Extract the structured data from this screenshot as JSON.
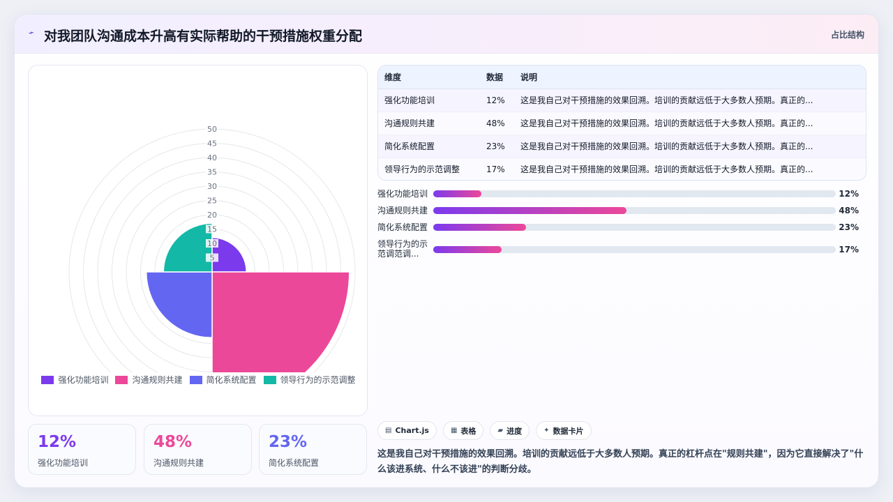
{
  "header": {
    "title": "对我团队沟通成本升高有实际帮助的干预措施权重分配",
    "tag": "占比结构",
    "logo_icon": "lightning-icon"
  },
  "chart_data": {
    "type": "polarArea",
    "categories": [
      "强化功能培训",
      "沟通规则共建",
      "简化系统配置",
      "领导行为的示范调整"
    ],
    "values": [
      12,
      48,
      23,
      17
    ],
    "colors": [
      "#7c3aed",
      "#ec4899",
      "#6366f1",
      "#14b8a6"
    ],
    "rlim": [
      0,
      50
    ],
    "ticks": [
      5,
      10,
      15,
      20,
      25,
      30,
      35,
      40,
      45,
      50
    ],
    "tick_labels": [
      "5",
      "10",
      "15",
      "20",
      "25",
      "30",
      "35",
      "40",
      "45",
      "50"
    ],
    "grid": true,
    "legend_position": "bottom"
  },
  "stats": [
    {
      "value": "12%",
      "label": "强化功能培训",
      "color": "#7c3aed"
    },
    {
      "value": "48%",
      "label": "沟通规则共建",
      "color": "#ec4899"
    },
    {
      "value": "23%",
      "label": "简化系统配置",
      "color": "#6366f1"
    }
  ],
  "table": {
    "headers": [
      "维度",
      "数据",
      "说明"
    ],
    "rows": [
      {
        "name": "强化功能培训",
        "value": "12%",
        "desc": "这是我自己对干预措施的效果回溯。培训的贡献远低于大多数人预期。真正的..."
      },
      {
        "name": "沟通规则共建",
        "value": "48%",
        "desc": "这是我自己对干预措施的效果回溯。培训的贡献远低于大多数人预期。真正的..."
      },
      {
        "name": "简化系统配置",
        "value": "23%",
        "desc": "这是我自己对干预措施的效果回溯。培训的贡献远低于大多数人预期。真正的..."
      },
      {
        "name": "领导行为的示范调整",
        "value": "17%",
        "desc": "这是我自己对干预措施的效果回溯。培训的贡献远低于大多数人预期。真正的..."
      }
    ]
  },
  "bars": [
    {
      "label": "强化功能培训",
      "value_text": "12%",
      "value": 12
    },
    {
      "label": "沟通规则共建",
      "value_text": "48%",
      "value": 48
    },
    {
      "label": "简化系统配置",
      "value_text": "23%",
      "value": 23
    },
    {
      "label": "领导行为的示范调范调...",
      "value_text": "17%",
      "value": 17
    }
  ],
  "chips": [
    {
      "icon": "chart-icon",
      "label": "Chart.js"
    },
    {
      "icon": "table-icon",
      "label": "表格"
    },
    {
      "icon": "progress-icon",
      "label": "进度"
    },
    {
      "icon": "sparkle-icon",
      "label": "数据卡片"
    }
  ],
  "summary": "这是我自己对干预措施的效果回溯。培训的贡献远低于大多数人预期。真正的杠杆点在\"规则共建\"，因为它直接解决了\"什么该进系统、什么不该进\"的判断分歧。"
}
